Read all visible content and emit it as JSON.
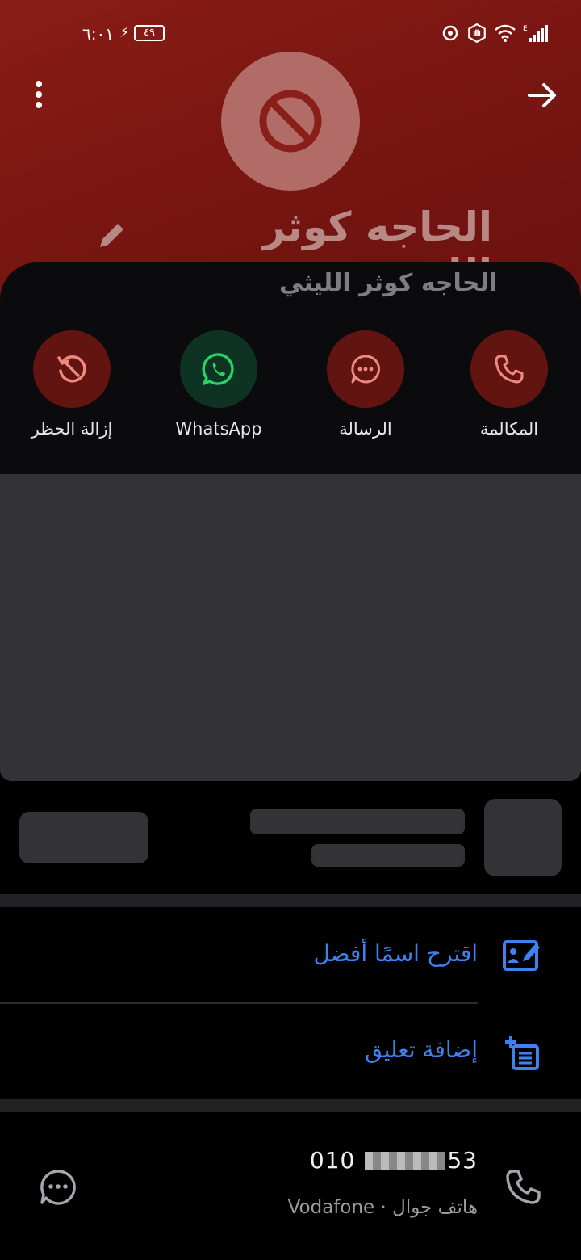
{
  "status_bar": {
    "time": "٦:٠١",
    "battery": "٤٩"
  },
  "contact": {
    "name": "الحاجه كوثر الليثي",
    "avatar_state": "blocked"
  },
  "actions": [
    {
      "label": "المكالمة",
      "icon": "phone-icon"
    },
    {
      "label": "الرسالة",
      "icon": "message-icon"
    },
    {
      "label": "WhatsApp",
      "icon": "whatsapp-icon"
    },
    {
      "label": "إزالة الحظر",
      "icon": "unblock-icon"
    }
  ],
  "options": {
    "suggest_name": "اقترح اسمًا أفضل",
    "add_comment": "إضافة تعليق"
  },
  "phone": {
    "prefix": "010",
    "suffix": "53",
    "type_carrier": "هاتف جوال · Vodafone"
  },
  "colors": {
    "header_red": "#7a1612",
    "accent_blue": "#3e82f0",
    "whatsapp_green": "#25d366"
  }
}
